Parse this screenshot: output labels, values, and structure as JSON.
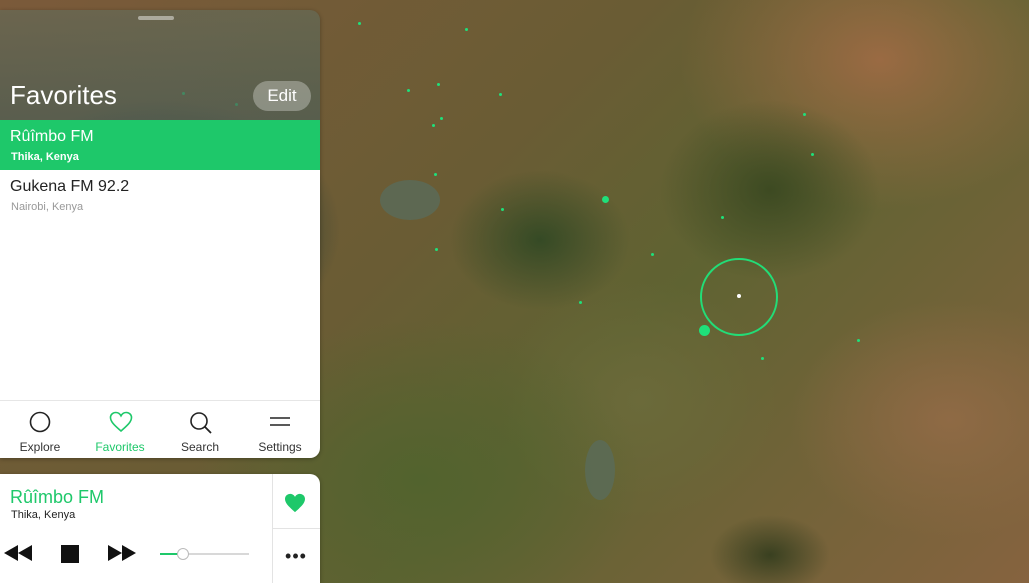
{
  "favorites_panel": {
    "title": "Favorites",
    "edit_label": "Edit",
    "stations": [
      {
        "name": "Rûîmbo FM",
        "location": "Thika, Kenya",
        "selected": true
      },
      {
        "name": "Gukena FM 92.2",
        "location": "Nairobi, Kenya",
        "selected": false
      }
    ]
  },
  "tabs": [
    {
      "label": "Explore",
      "icon": "circle-icon",
      "active": false
    },
    {
      "label": "Favorites",
      "icon": "heart-outline-icon",
      "active": true
    },
    {
      "label": "Search",
      "icon": "search-icon",
      "active": false
    },
    {
      "label": "Settings",
      "icon": "menu-icon",
      "active": false
    }
  ],
  "player": {
    "station_name": "Rûîmbo FM",
    "station_location": "Thika, Kenya",
    "favorited": true,
    "volume": 0.26,
    "more_label": "•••"
  },
  "colors": {
    "accent": "#1ec86a",
    "station_dot": "#1fe07a"
  }
}
